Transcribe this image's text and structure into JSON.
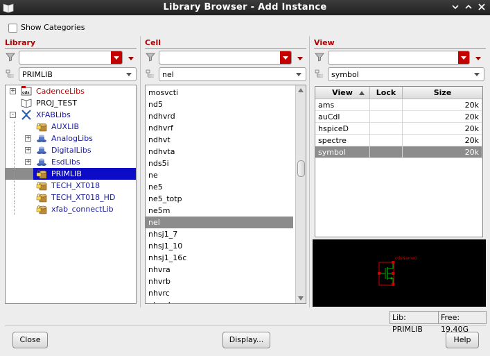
{
  "window": {
    "title": "Library Browser - Add Instance",
    "controls": [
      "minimize-icon",
      "maximize-icon",
      "close-icon"
    ]
  },
  "options": {
    "show_categories_label": "Show Categories",
    "show_categories_checked": false
  },
  "library": {
    "title": "Library",
    "filter_value": "",
    "selected_value": "PRIMLIB",
    "tree": [
      {
        "label": "CadenceLibs",
        "color": "#b00000",
        "expander": "+",
        "icon": "cds-library-icon"
      },
      {
        "label": "PROJ_TEST",
        "color": "#000000",
        "expander": "",
        "icon": "book-icon"
      },
      {
        "label": "XFABLibs",
        "color": "#1a1a9c",
        "expander": "-",
        "icon": "xfab-logo-icon"
      },
      {
        "label": "AUXLIB",
        "color": "#1a1a9c",
        "expander": "",
        "icon": "locked-library-icon"
      },
      {
        "label": "AnalogLibs",
        "color": "#1a1a9c",
        "expander": "+",
        "icon": "library-group-icon"
      },
      {
        "label": "DigitalLibs",
        "color": "#1a1a9c",
        "expander": "+",
        "icon": "library-group-icon"
      },
      {
        "label": "EsdLibs",
        "color": "#1a1a9c",
        "expander": "+",
        "icon": "library-group-icon"
      },
      {
        "label": "PRIMLIB",
        "color": "#ffffff",
        "expander": "",
        "icon": "locked-library-icon",
        "selected": true
      },
      {
        "label": "TECH_XT018",
        "color": "#1a1a9c",
        "expander": "",
        "icon": "locked-library-icon"
      },
      {
        "label": "TECH_XT018_HD",
        "color": "#1a1a9c",
        "expander": "",
        "icon": "locked-library-icon"
      },
      {
        "label": "xfab_connectLib",
        "color": "#1a1a9c",
        "expander": "",
        "icon": "locked-library-icon"
      }
    ]
  },
  "cell": {
    "title": "Cell",
    "filter_value": "",
    "selected_value": "nel",
    "items": [
      "mosvcti",
      "nd5",
      "ndhvrd",
      "ndhvrf",
      "ndhvt",
      "ndhvta",
      "nds5i",
      "ne",
      "ne5",
      "ne5_totp",
      "ne5m",
      "nel",
      "nhsj1_7",
      "nhsj1_10",
      "nhsj1_16c",
      "nhvra",
      "nhvrb",
      "nhvrc",
      "nhvrd"
    ],
    "selected_index": 11
  },
  "view": {
    "title": "View",
    "filter_value": "",
    "selected_value": "symbol",
    "columns": [
      "View",
      "Lock",
      "Size"
    ],
    "rows": [
      {
        "view": "ams",
        "lock": "",
        "size": "20k"
      },
      {
        "view": "auCdl",
        "lock": "",
        "size": "20k"
      },
      {
        "view": "hspiceD",
        "lock": "",
        "size": "20k"
      },
      {
        "view": "spectre",
        "lock": "",
        "size": "20k"
      },
      {
        "view": "symbol",
        "lock": "",
        "size": "20k",
        "selected": true
      }
    ],
    "preview_label": "cdsName()"
  },
  "status": {
    "lib": "Lib: PRIMLIB",
    "free": "Free: 19.40G"
  },
  "buttons": {
    "close": "Close",
    "display": "Display...",
    "help": "Help"
  },
  "colors": {
    "section_title": "#b00000",
    "combo_accent": "#c40000",
    "selection_gray": "#8c8c8c",
    "tree_selection": "#0c0cc8",
    "library_link": "#1a1a9c"
  }
}
